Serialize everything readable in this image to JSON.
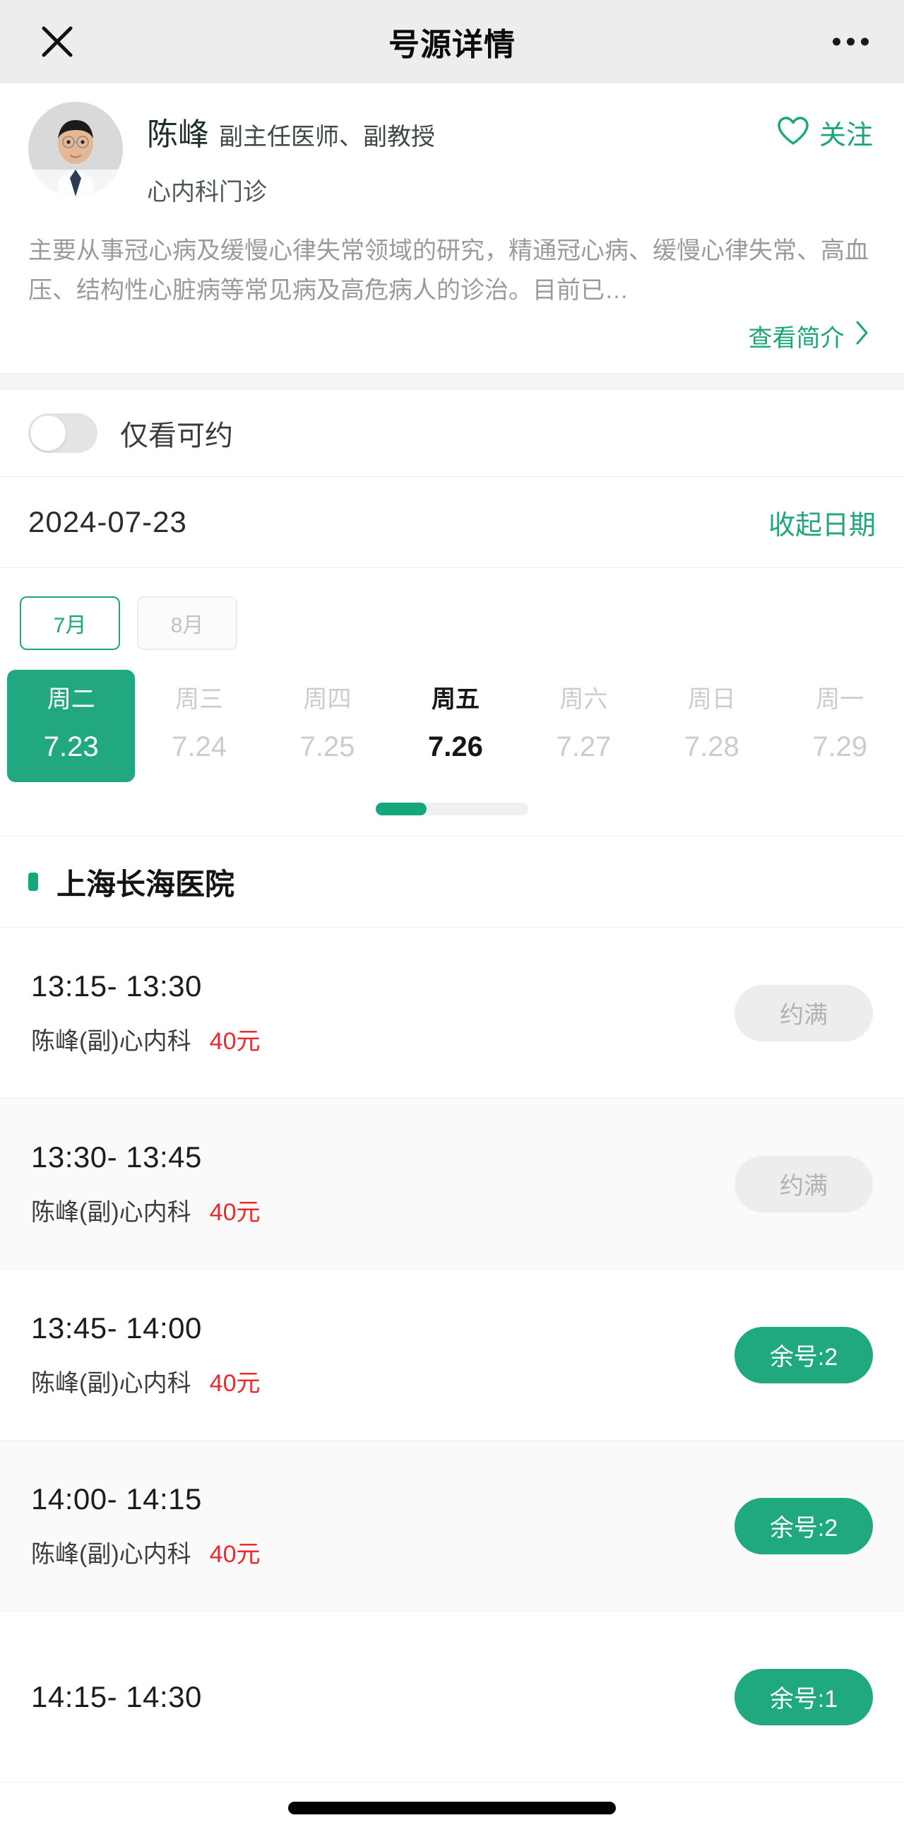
{
  "navbar": {
    "close_icon": "close-icon",
    "title": "号源详情",
    "more_icon": "more-options-icon"
  },
  "doctor": {
    "avatar_icon": "doctor-avatar",
    "name": "陈峰",
    "title": "副主任医师、副教授",
    "department": "心内科门诊",
    "follow": {
      "icon": "heart-outline-icon",
      "label": "关注",
      "color": "#1aa67b"
    },
    "description": "主要从事冠心病及缓慢心律失常领域的研究，精通冠心病、缓慢心律失常、高血压、结构性心脏病等常见病及高危病人的诊治。目前已…",
    "more_label": "查看简介",
    "more_icon": "chevron-right-icon"
  },
  "filter": {
    "toggle_state": "off",
    "label": "仅看可约"
  },
  "date_header": {
    "selected_date": "2024-07-23",
    "collapse_label": "收起日期"
  },
  "month_tabs": [
    {
      "label": "7月",
      "active": true
    },
    {
      "label": "8月",
      "active": false
    }
  ],
  "week_days": [
    {
      "dow": "周二",
      "date": "7.23",
      "state": "selected"
    },
    {
      "dow": "周三",
      "date": "7.24",
      "state": "normal"
    },
    {
      "dow": "周四",
      "date": "7.25",
      "state": "normal"
    },
    {
      "dow": "周五",
      "date": "7.26",
      "state": "available"
    },
    {
      "dow": "周六",
      "date": "7.27",
      "state": "normal"
    },
    {
      "dow": "周日",
      "date": "7.28",
      "state": "normal"
    },
    {
      "dow": "周一",
      "date": "7.29",
      "state": "normal"
    }
  ],
  "scroll_indicator": {
    "position_percent": 0
  },
  "hospital": {
    "dot_color": "#16a67d",
    "name": "上海长海医院"
  },
  "slots": [
    {
      "time": "13:15- 13:30",
      "doctor": "陈峰(副)心内科",
      "price": "40元",
      "button_label": "约满",
      "status": "full"
    },
    {
      "time": "13:30- 13:45",
      "doctor": "陈峰(副)心内科",
      "price": "40元",
      "button_label": "约满",
      "status": "full"
    },
    {
      "time": "13:45- 14:00",
      "doctor": "陈峰(副)心内科",
      "price": "40元",
      "button_label": "余号:2",
      "status": "available"
    },
    {
      "time": "14:00- 14:15",
      "doctor": "陈峰(副)心内科",
      "price": "40元",
      "button_label": "余号:2",
      "status": "available"
    },
    {
      "time": "14:15- 14:30",
      "doctor": "",
      "price": "",
      "button_label": "余号:1",
      "status": "available"
    }
  ],
  "colors": {
    "brand_green": "#21a57d",
    "selected_green": "#21a880",
    "price_red": "#f02a2a",
    "disabled_gray": "#ededed"
  }
}
